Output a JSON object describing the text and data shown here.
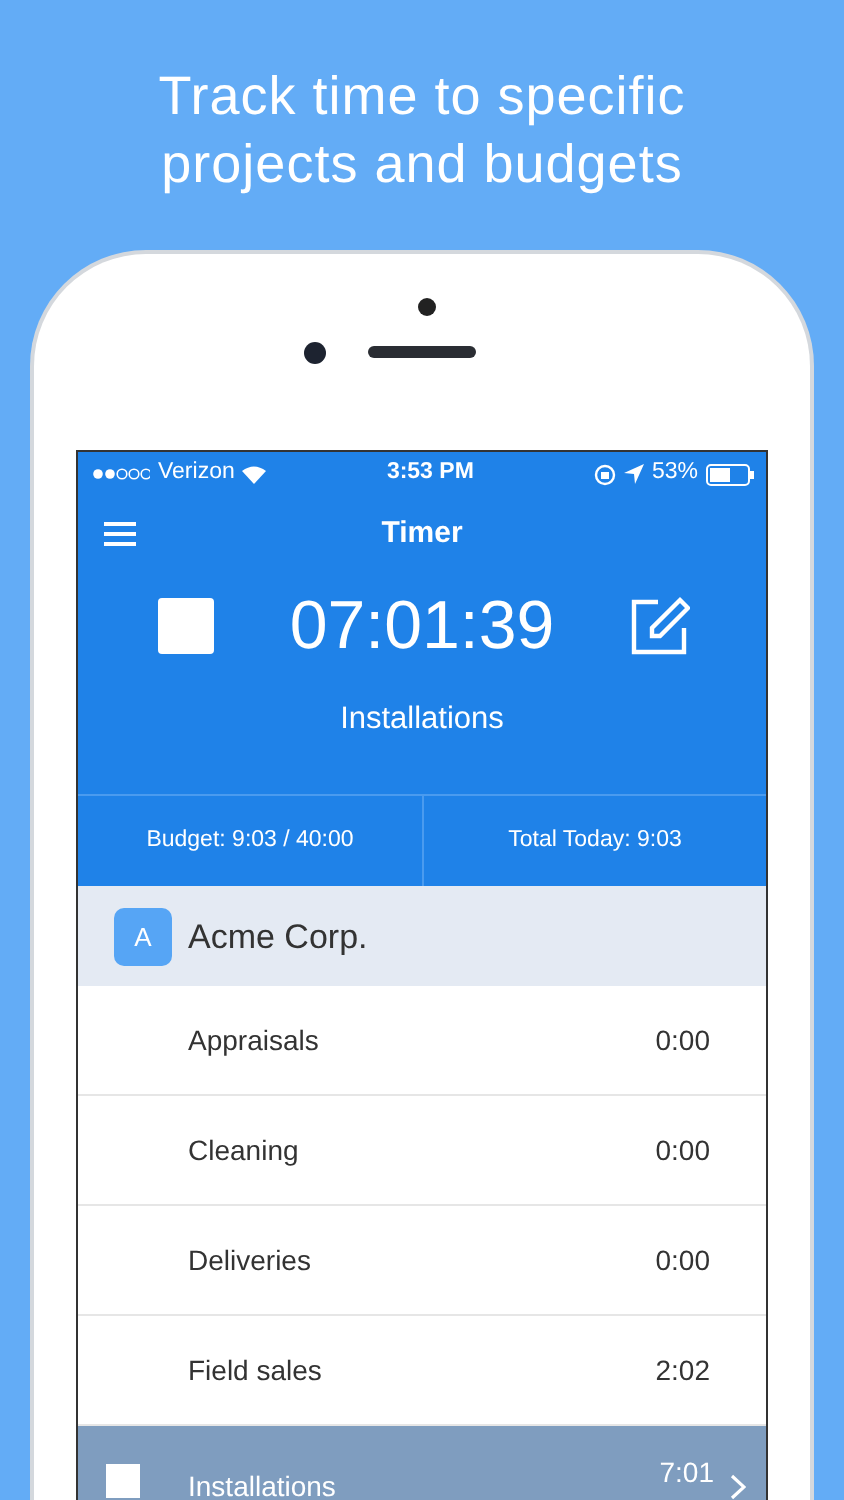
{
  "headline": "Track time to specific projects and budgets",
  "status_bar": {
    "carrier": "Verizon",
    "time": "3:53 PM",
    "battery": "53%"
  },
  "nav": {
    "title": "Timer"
  },
  "timer": {
    "running": true,
    "elapsed": "07:01:39",
    "task": "Installations"
  },
  "summary": [
    {
      "text": "Budget: 9:03 / 40:00"
    },
    {
      "text": "Total Today: 9:03"
    }
  ],
  "client": {
    "initial": "A",
    "name": "Acme Corp."
  },
  "tasks": [
    {
      "name": "Appraisals",
      "time": "0:00",
      "selected": false
    },
    {
      "name": "Cleaning",
      "time": "0:00",
      "selected": false
    },
    {
      "name": "Deliveries",
      "time": "0:00",
      "selected": false
    },
    {
      "name": "Field sales",
      "time": "2:02",
      "selected": false
    },
    {
      "name": "Installations",
      "time": "7:01",
      "selected": true
    }
  ]
}
